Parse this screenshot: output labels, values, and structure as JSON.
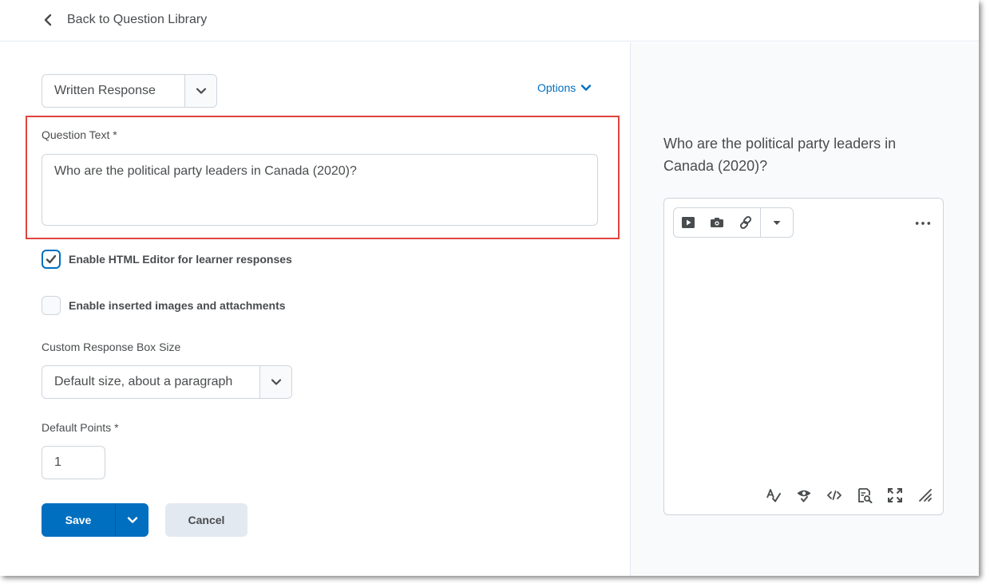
{
  "header": {
    "back_label": "Back to Question Library"
  },
  "question_type": {
    "selected": "Written Response"
  },
  "options": {
    "label": "Options"
  },
  "question_text": {
    "label": "Question Text",
    "value": "Who are the political party leaders in Canada (2020)?"
  },
  "required_marker": "*",
  "checkboxes": [
    {
      "label": "Enable HTML Editor for learner responses",
      "checked": true
    },
    {
      "label": "Enable inserted images and attachments",
      "checked": false
    }
  ],
  "response_size": {
    "label": "Custom Response Box Size",
    "selected": "Default size, about a paragraph"
  },
  "points": {
    "label": "Default Points",
    "value": "1"
  },
  "actions": {
    "save_label": "Save",
    "cancel_label": "Cancel"
  },
  "preview": {
    "question": "Who are the political party leaders in Canada (2020)?"
  },
  "colors": {
    "accent": "#006fbf",
    "highlight": "#e0443f",
    "text": "#494c4e"
  },
  "icons": {
    "toolbar": [
      "insert-stuff-icon",
      "insert-image-icon",
      "insert-link-icon",
      "caret-down-icon",
      "more-icon"
    ],
    "bottom": [
      "spellcheck-icon",
      "accessibility-check-icon",
      "source-code-icon",
      "preview-icon",
      "fullscreen-icon",
      "resize-icon"
    ]
  }
}
